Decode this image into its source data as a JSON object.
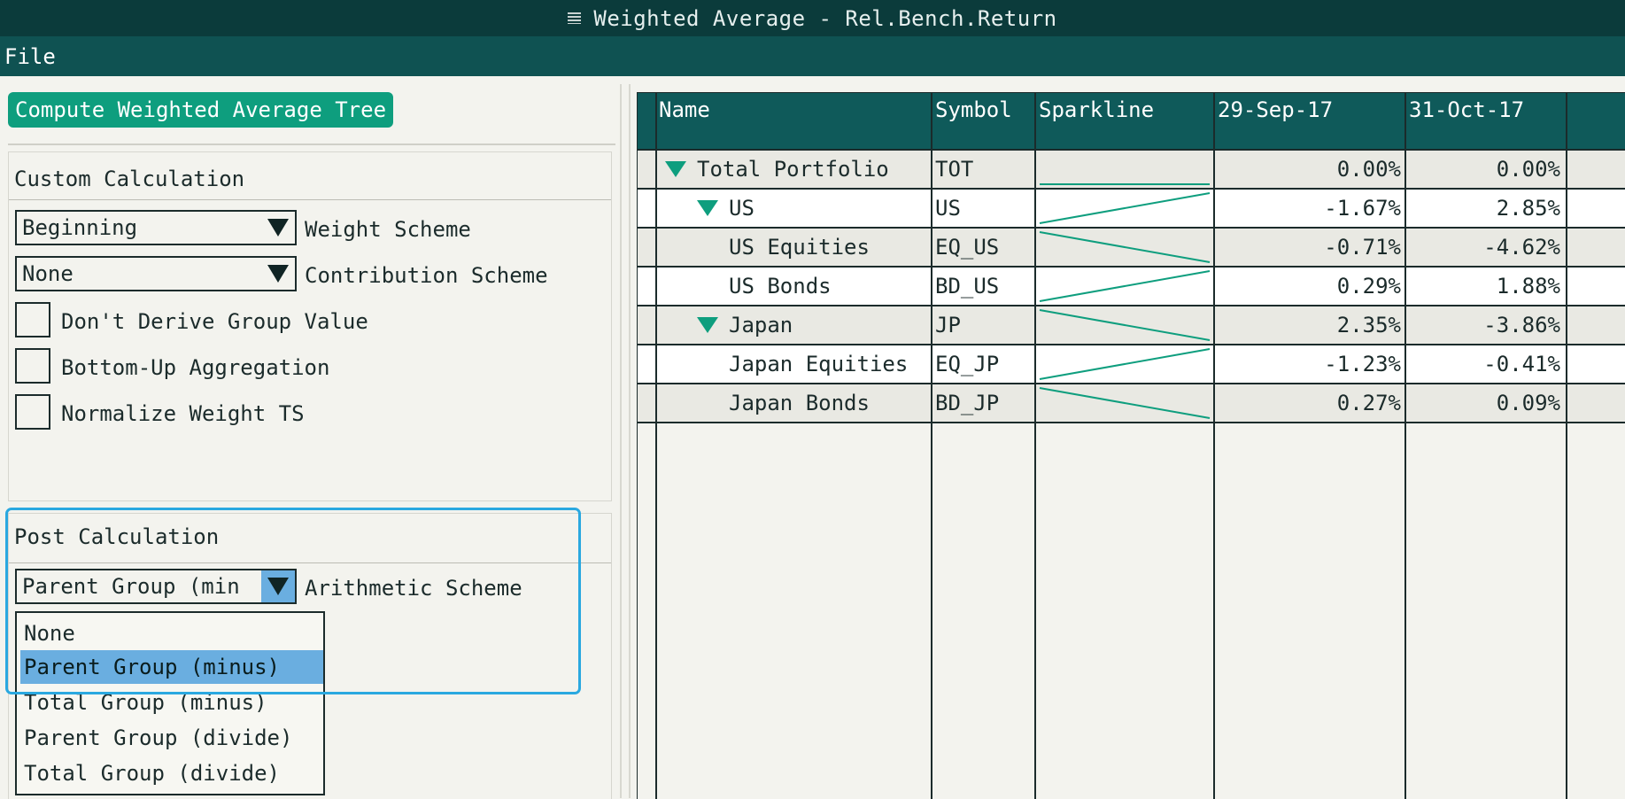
{
  "window": {
    "title": "Weighted Average - Rel.Bench.Return",
    "icon": "window-menu-icon"
  },
  "menubar": {
    "items": [
      "File"
    ]
  },
  "left": {
    "compute_button": "Compute Weighted Average Tree",
    "custom_calc": {
      "title": "Custom Calculation",
      "weight_scheme": {
        "value": "Beginning",
        "label": "Weight Scheme"
      },
      "contribution_scheme": {
        "value": "None",
        "label": "Contribution Scheme"
      },
      "checkboxes": [
        {
          "label": "Don't Derive Group Value",
          "checked": false
        },
        {
          "label": "Bottom-Up Aggregation",
          "checked": false
        },
        {
          "label": "Normalize Weight TS",
          "checked": false
        }
      ]
    },
    "post_calc": {
      "title": "Post Calculation",
      "arithmetic_scheme": {
        "value": "Parent Group (min",
        "label": "Arithmetic Scheme"
      },
      "options": [
        "None",
        "Parent Group (minus)",
        "Total Group (minus)",
        "Parent Group (divide)",
        "Total Group (divide)"
      ],
      "selected_index": 1
    }
  },
  "grid": {
    "columns": [
      "Name",
      "Symbol",
      "Sparkline",
      "29-Sep-17",
      "31-Oct-17"
    ],
    "rows": [
      {
        "name": "Total Portfolio",
        "symbol": "TOT",
        "v1": "0.00%",
        "v2": "0.00%",
        "level": 0,
        "expanded": true,
        "spark": [
          0.0,
          0.0
        ]
      },
      {
        "name": "US",
        "symbol": "US",
        "v1": "-1.67%",
        "v2": "2.85%",
        "level": 1,
        "expanded": true,
        "spark": [
          -1.67,
          2.85
        ]
      },
      {
        "name": "US Equities",
        "symbol": "EQ_US",
        "v1": "-0.71%",
        "v2": "-4.62%",
        "level": 2,
        "expanded": false,
        "spark": [
          -0.71,
          -4.62
        ]
      },
      {
        "name": "US Bonds",
        "symbol": "BD_US",
        "v1": "0.29%",
        "v2": "1.88%",
        "level": 2,
        "expanded": false,
        "spark": [
          0.29,
          1.88
        ]
      },
      {
        "name": "Japan",
        "symbol": "JP",
        "v1": "2.35%",
        "v2": "-3.86%",
        "level": 1,
        "expanded": true,
        "spark": [
          2.35,
          -3.86
        ]
      },
      {
        "name": "Japan Equities",
        "symbol": "EQ_JP",
        "v1": "-1.23%",
        "v2": "-0.41%",
        "level": 2,
        "expanded": false,
        "spark": [
          -1.23,
          -0.41
        ]
      },
      {
        "name": "Japan Bonds",
        "symbol": "BD_JP",
        "v1": "0.27%",
        "v2": "0.09%",
        "level": 2,
        "expanded": false,
        "spark": [
          0.27,
          0.09
        ]
      }
    ]
  },
  "colors": {
    "accent": "#0e9e7e",
    "header": "#0f5a5a",
    "titlebar": "#0b3b3b",
    "selection": "#6aaee0",
    "focus": "#2aa8e0"
  }
}
